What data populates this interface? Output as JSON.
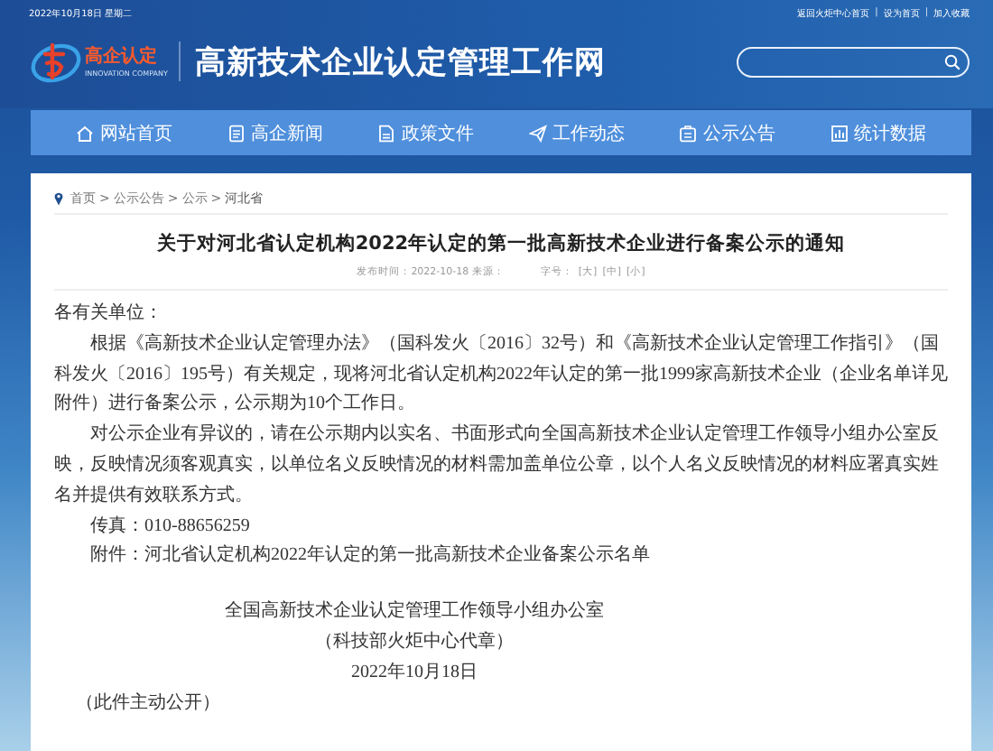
{
  "top_bar": {
    "date": "2022年10月18日 星期二",
    "links": [
      "返回火炬中心首页",
      "设为首页",
      "加入收藏"
    ],
    "separators": [
      "|",
      "|"
    ]
  },
  "logo": {
    "name": "高企认定",
    "subtitle": "INNOVATION COMPANY"
  },
  "site_title": "高新技术企业认定管理工作网",
  "nav": [
    {
      "label": "网站首页",
      "kind": "home"
    },
    {
      "label": "高企新闻",
      "kind": "news"
    },
    {
      "label": "政策文件",
      "kind": "policy"
    },
    {
      "label": "工作动态",
      "kind": "updates"
    },
    {
      "label": "公示公告",
      "kind": "notices"
    },
    {
      "label": "统计数据",
      "kind": "statistics"
    }
  ],
  "breadcrumb": [
    {
      "kind": "link",
      "label": "首页"
    },
    {
      "kind": "sep",
      "label": ">"
    },
    {
      "kind": "link",
      "label": "公示公告"
    },
    {
      "kind": "sep",
      "label": ">"
    },
    {
      "kind": "link",
      "label": "公示"
    },
    {
      "kind": "sep",
      "label": ">"
    },
    {
      "kind": "current",
      "label": "河北省"
    }
  ],
  "article": {
    "title": "关于对河北省认定机构2022年认定的第一批高新技术企业进行备案公示的通知",
    "meta": "发布时间：2022-10-18 来源：",
    "font_size_label": "字号：",
    "font_sizes": [
      "[大]",
      "[中]",
      "[小]"
    ],
    "body": [
      {
        "kind": "greeting",
        "text": "各有关单位："
      },
      {
        "kind": "para",
        "text": "根据《高新技术企业认定管理办法》（国科发火〔2016〕32号）和《高新技术企业认定管理工作指引》（国科发火〔2016〕195号）有关规定，现将河北省认定机构2022年认定的第一批1999家高新技术企业（企业名单详见附件）进行备案公示，公示期为10个工作日。"
      },
      {
        "kind": "para",
        "text": "对公示企业有异议的，请在公示期内以实名、书面形式向全国高新技术企业认定管理工作领导小组办公室反映，反映情况须客观真实，以单位名义反映情况的材料需加盖单位公章，以个人名义反映情况的材料应署真实姓名并提供有效联系方式。"
      },
      {
        "kind": "para",
        "text": "传真：010-88656259"
      },
      {
        "kind": "para",
        "text": "附件：河北省认定机构2022年认定的第一批高新技术企业备案公示名单"
      },
      {
        "kind": "gap"
      },
      {
        "kind": "sign",
        "text": "全国高新技术企业认定管理工作领导小组办公室"
      },
      {
        "kind": "sign",
        "text": "（科技部火炬中心代章）"
      },
      {
        "kind": "sign",
        "text": "2022年10月18日"
      },
      {
        "kind": "note",
        "text": "（此件主动公开）"
      }
    ]
  }
}
